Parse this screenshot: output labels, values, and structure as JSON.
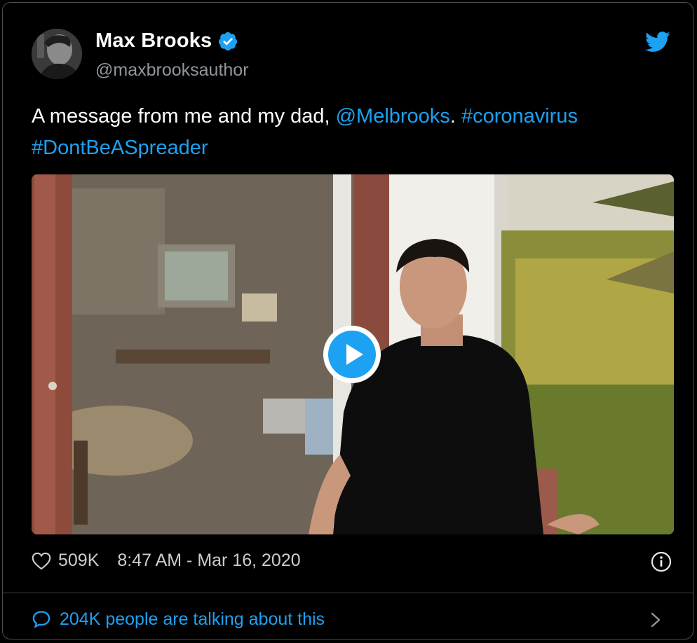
{
  "author": {
    "display_name": "Max Brooks",
    "handle": "@maxbrooksauthor",
    "verified": true
  },
  "tweet": {
    "text_prefix": "A message from me and my dad, ",
    "mention": "@Melbrooks",
    "separator": ". ",
    "hashtag_1": "#coronavirus",
    "hashtag_2": "#DontBeASpreader"
  },
  "stats": {
    "likes": "509K",
    "timestamp": "8:47 AM - Mar 16, 2020"
  },
  "footer": {
    "conversation_text": "204K people are talking about this"
  },
  "colors": {
    "background": "#000000",
    "link": "#1da1f2",
    "border": "#4a4f55",
    "secondary_text": "#8f969c"
  },
  "icons": {
    "brand": "twitter-bird-icon",
    "verified": "verified-badge-icon",
    "like": "heart-icon",
    "info": "info-icon",
    "reply": "speech-bubble-icon",
    "more": "chevron-right-icon",
    "play": "play-icon"
  }
}
